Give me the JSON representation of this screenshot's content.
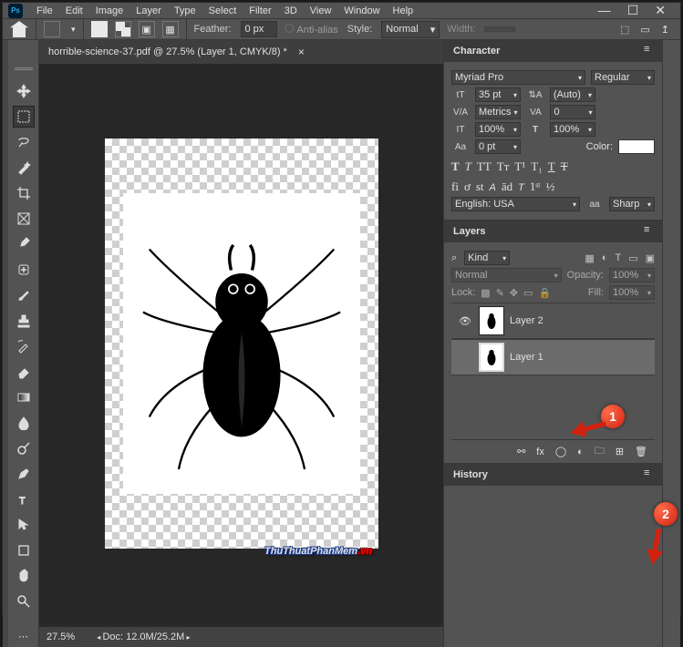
{
  "logo_abbr": "Ps",
  "menus": [
    "File",
    "Edit",
    "Image",
    "Layer",
    "Type",
    "Select",
    "Filter",
    "3D",
    "View",
    "Window",
    "Help"
  ],
  "options": {
    "feather_label": "Feather:",
    "feather_value": "0 px",
    "antialias": "Anti-alias",
    "style_label": "Style:",
    "style_value": "Normal",
    "width_label": "Width:"
  },
  "doc": {
    "tab_title": "horrible-science-37.pdf @ 27.5% (Layer 1, CMYK/8) *",
    "zoom": "27.5%",
    "doc_size": "Doc: 12.0M/25.2M"
  },
  "character": {
    "title": "Character",
    "font": "Myriad Pro",
    "style": "Regular",
    "size_icon": "tT",
    "size": "35 pt",
    "leading_icon": "⇅A",
    "leading": "(Auto)",
    "kerning_icon": "V/A",
    "kerning": "Metrics",
    "tracking_icon": "VA",
    "tracking": "0",
    "vscale_icon": "IT",
    "vscale": "100%",
    "hscale_icon": "T",
    "hscale": "100%",
    "baseline_icon": "Aa",
    "baseline": "0 pt",
    "color_label": "Color:",
    "lang": "English: USA",
    "aa_icon": "aa",
    "aa": "Sharp"
  },
  "layers": {
    "title": "Layers",
    "filter": "Kind",
    "blend": "Normal",
    "opacity_label": "Opacity:",
    "opacity": "100%",
    "lock_label": "Lock:",
    "fill_label": "Fill:",
    "fill": "100%",
    "items": [
      {
        "name": "Layer 2",
        "visible": true
      },
      {
        "name": "Layer 1",
        "visible": false
      }
    ]
  },
  "history": {
    "title": "History"
  },
  "annotations": {
    "one": "1",
    "two": "2"
  },
  "watermark": {
    "main": "ThuThuatPhanMem",
    "suffix": ".vn"
  }
}
